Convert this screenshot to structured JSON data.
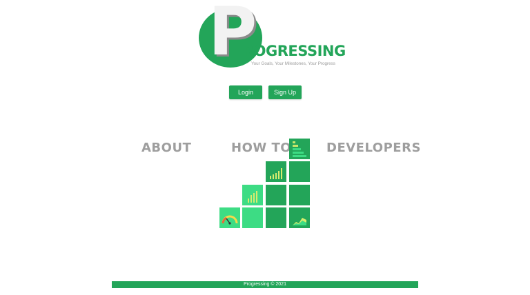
{
  "logo": {
    "letter": "P",
    "wordmark": "ROGRESSING",
    "tagline": "Your Goals, Your Milestones, Your Progress"
  },
  "auth": {
    "login_label": "Login",
    "signup_label": "Sign Up"
  },
  "nav": {
    "about": "ABOUT",
    "how_to": "HOW TO",
    "developers": "DEVELOPERS"
  },
  "icons": {
    "staircase": [
      "speedometer-icon",
      "bar-chart-icon",
      "bar-chart-small-icon",
      "level-bars-icon",
      "area-chart-icon"
    ]
  },
  "colors": {
    "brand_green": "#23a559",
    "bright_green": "#3ddc84",
    "nav_gray": "#9e9e9e"
  },
  "footer": {
    "text": "Progressing © 2021"
  }
}
